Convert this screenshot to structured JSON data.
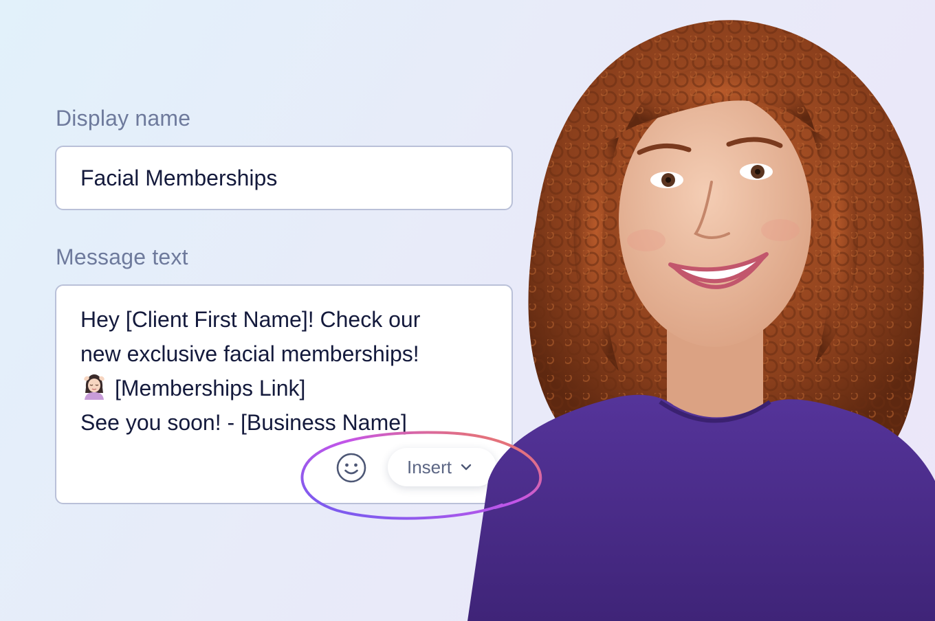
{
  "form": {
    "display_name_label": "Display name",
    "display_name_value": "Facial Memberships",
    "message_label": "Message text",
    "message_lines": [
      "Hey [Client First Name]! Check our",
      "new exclusive facial memberships!",
      "[Memberships Link]",
      "See you soon! - [Business Name]"
    ],
    "emoji_in_message": "person-getting-facial-emoji",
    "toolbar": {
      "emoji_icon": "smiley-icon",
      "insert_label": "Insert",
      "insert_icon": "chevron-down-icon"
    }
  },
  "colors": {
    "label": "#6e7a9c",
    "text": "#141a3c",
    "border": "#b9c0d8",
    "shirt": "#4b2d86",
    "hair": "#8a3f1c",
    "highlight_gradient": [
      "#6b5cf0",
      "#c455e8",
      "#f27f4a"
    ]
  },
  "portrait": {
    "subject": "smiling woman with curly auburn hair in purple t-shirt"
  }
}
